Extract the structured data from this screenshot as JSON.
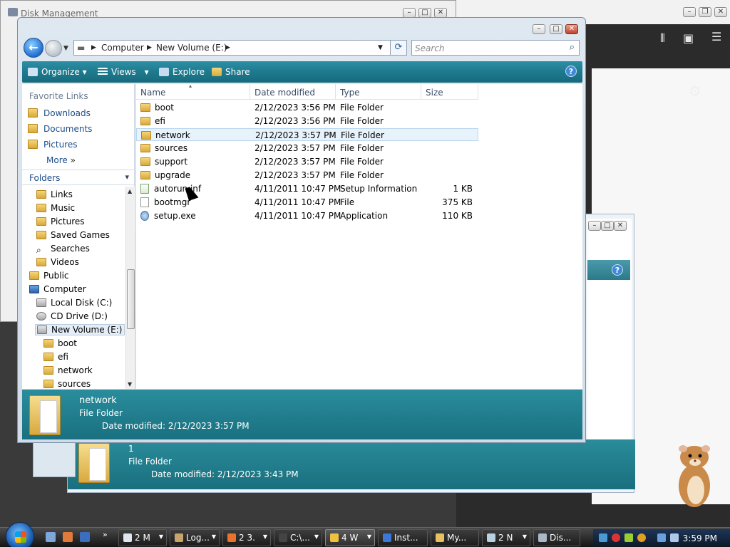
{
  "disk_management": {
    "title": "Disk Management"
  },
  "explorer": {
    "breadcrumb": [
      "Computer",
      "New Volume (E:)"
    ],
    "search_placeholder": "Search",
    "toolbar": {
      "organize": "Organize",
      "views": "Views",
      "explore": "Explore",
      "share": "Share",
      "help": "?"
    },
    "favorites_title": "Favorite Links",
    "favorites": [
      "Downloads",
      "Documents",
      "Pictures"
    ],
    "more_label": "More",
    "folders_label": "Folders",
    "tree": [
      "Links",
      "Music",
      "Pictures",
      "Saved Games",
      "Searches",
      "Videos",
      "Public",
      "Computer",
      "Local Disk (C:)",
      "CD Drive (D:)",
      "New Volume (E:)",
      "boot",
      "efi",
      "network",
      "sources"
    ],
    "columns": {
      "name": "Name",
      "date": "Date modified",
      "type": "Type",
      "size": "Size"
    },
    "files": [
      {
        "name": "boot",
        "date": "2/12/2023 3:56 PM",
        "type": "File Folder",
        "size": "",
        "kind": "folder"
      },
      {
        "name": "efi",
        "date": "2/12/2023 3:56 PM",
        "type": "File Folder",
        "size": "",
        "kind": "folder"
      },
      {
        "name": "network",
        "date": "2/12/2023 3:57 PM",
        "type": "File Folder",
        "size": "",
        "kind": "folder"
      },
      {
        "name": "sources",
        "date": "2/12/2023 3:57 PM",
        "type": "File Folder",
        "size": "",
        "kind": "folder"
      },
      {
        "name": "support",
        "date": "2/12/2023 3:57 PM",
        "type": "File Folder",
        "size": "",
        "kind": "folder"
      },
      {
        "name": "upgrade",
        "date": "2/12/2023 3:57 PM",
        "type": "File Folder",
        "size": "",
        "kind": "folder"
      },
      {
        "name": "autorun.inf",
        "date": "4/11/2011 10:47 PM",
        "type": "Setup Information",
        "size": "1 KB",
        "kind": "inf"
      },
      {
        "name": "bootmgr",
        "date": "4/11/2011 10:47 PM",
        "type": "File",
        "size": "375 KB",
        "kind": "file"
      },
      {
        "name": "setup.exe",
        "date": "4/11/2011 10:47 PM",
        "type": "Application",
        "size": "110 KB",
        "kind": "exe"
      }
    ],
    "selected_index": 2,
    "details": {
      "name": "network",
      "type": "File Folder",
      "date_label": "Date modified:",
      "date": "2/12/2023 3:57 PM"
    }
  },
  "back_window_details": {
    "name": "1",
    "type": "File Folder",
    "date_label": "Date modified:",
    "date": "2/12/2023 3:43 PM"
  },
  "taskbar": {
    "buttons": [
      "2 M",
      "Log...",
      "2 3.",
      "C:\\...",
      "4 W",
      "Inst...",
      "My...",
      "2 N",
      "Dis..."
    ],
    "clock": "3:59 PM"
  },
  "colors": {
    "command_bar": "#1e7a8e",
    "details_pane": "#197080",
    "taskbar": "#141414"
  }
}
